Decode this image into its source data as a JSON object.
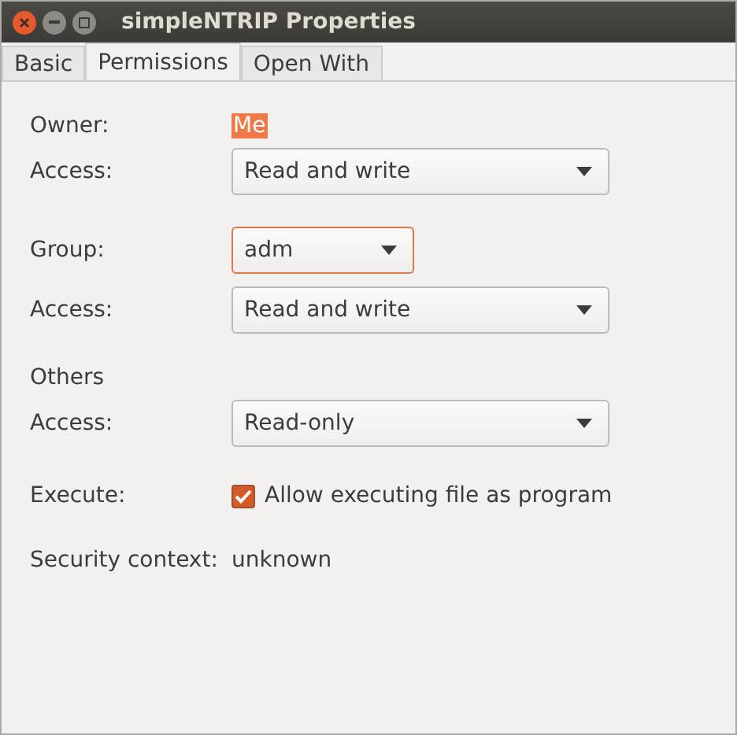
{
  "window": {
    "title": "simpleNTRIP Properties"
  },
  "tabs": [
    {
      "label": "Basic",
      "selected": false
    },
    {
      "label": "Permissions",
      "selected": true
    },
    {
      "label": "Open With",
      "selected": false
    }
  ],
  "rows": [
    {
      "kind": "owner",
      "label": "Owner:",
      "value": "Me",
      "highlighted": true
    },
    {
      "kind": "dropdown",
      "label": "Access:",
      "value": "Read and write",
      "focused": false
    },
    {
      "kind": "group",
      "label": "Group:",
      "value": "adm",
      "focused": true
    },
    {
      "kind": "dropdown",
      "label": "Access:",
      "value": "Read and write",
      "focused": false
    },
    {
      "kind": "heading",
      "label": "Others"
    },
    {
      "kind": "dropdown",
      "label": "Access:",
      "value": "Read-only",
      "focused": false
    },
    {
      "kind": "checkbox",
      "label": "Execute:",
      "value": "Allow executing file as program",
      "checked": true
    },
    {
      "kind": "info",
      "label": "Security context:",
      "value": "unknown"
    }
  ]
}
